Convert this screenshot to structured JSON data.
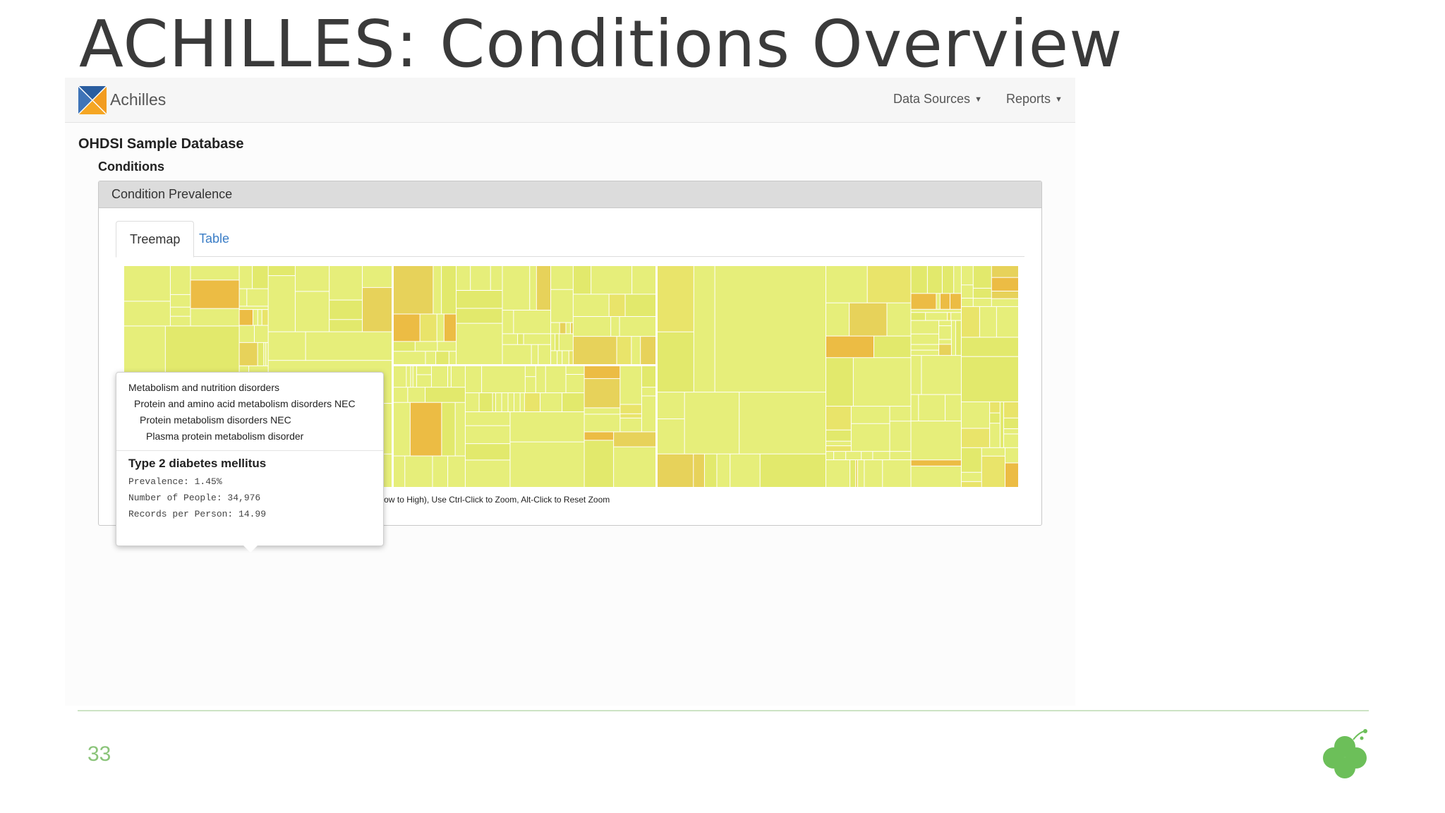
{
  "slide": {
    "title": "ACHILLES: Conditions Overview",
    "page_number": "33"
  },
  "app": {
    "brand": "Achilles",
    "nav": {
      "data_sources": "Data Sources",
      "reports": "Reports"
    },
    "database_name": "OHDSI Sample Database",
    "section_title": "Conditions",
    "panel_title": "Condition Prevalence",
    "tabs": {
      "treemap": "Treemap",
      "table": "Table"
    },
    "treemap_caption": "Box Size: Prevalence, Color: Records per Person (Blue to Orange = Low to High), Use Ctrl-Click to Zoom, Alt-Click to Reset Zoom",
    "tooltip": {
      "path": [
        "Metabolism and nutrition disorders",
        "Protein and amino acid metabolism disorders NEC",
        "Protein metabolism disorders NEC",
        "Plasma protein metabolism disorder"
      ],
      "condition": "Type 2 diabetes mellitus",
      "prevalence": "Prevalence: 1.45%",
      "people": "Number of People: 34,976",
      "records_per_person": "Records per Person: 14.99"
    }
  },
  "colors": {
    "treemap_light": "#e6ee7a",
    "treemap_mid": "#e7d25a",
    "treemap_dark": "#ecbc44",
    "accent_green": "#8bc47a",
    "tab_link": "#3a7dc6"
  },
  "icons": {
    "logo": "achilles-logo-icon",
    "caret": "caret-down-icon",
    "footer": "clover-logo-icon"
  }
}
